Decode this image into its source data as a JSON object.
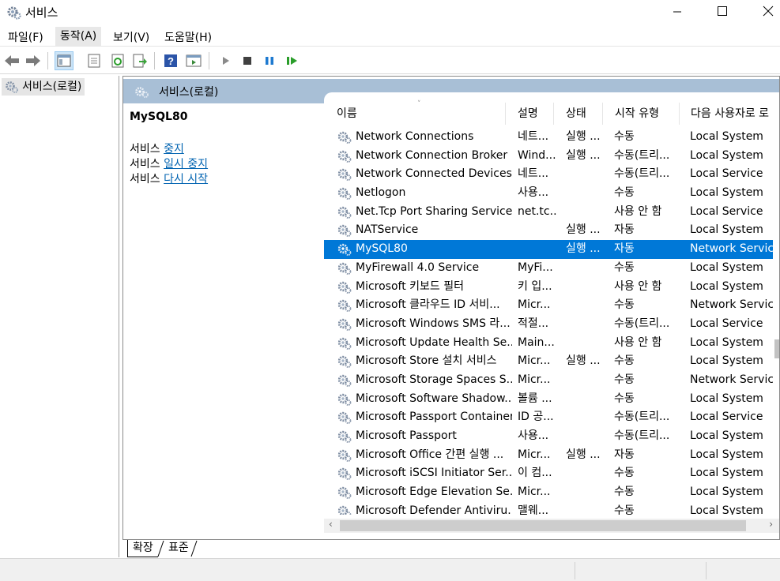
{
  "window": {
    "title": "서비스"
  },
  "menu": {
    "file": "파일(F)",
    "action": "동작(A)",
    "view": "보기(V)",
    "help": "도움말(H)"
  },
  "tree": {
    "root": "서비스(로컬)"
  },
  "main": {
    "header": "서비스(로컬)",
    "selected_service": "MySQL80",
    "actions": [
      {
        "prefix": "서비스 ",
        "link": "중지"
      },
      {
        "prefix": "서비스 ",
        "link": "일시 중지"
      },
      {
        "prefix": "서비스 ",
        "link": "다시 시작"
      }
    ]
  },
  "columns": {
    "name": "이름",
    "description": "설명",
    "status": "상태",
    "startup": "시작 유형",
    "logon": "다음 사용자로 로"
  },
  "rows": [
    {
      "name": "Network Connections",
      "desc": "네트...",
      "status": "실행 ...",
      "start": "수동",
      "logon": "Local System"
    },
    {
      "name": "Network Connection Broker",
      "desc": "Wind...",
      "status": "실행 ...",
      "start": "수동(트리...",
      "logon": "Local System"
    },
    {
      "name": "Network Connected Devices...",
      "desc": "네트...",
      "status": "",
      "start": "수동(트리...",
      "logon": "Local Service"
    },
    {
      "name": "Netlogon",
      "desc": "사용...",
      "status": "",
      "start": "수동",
      "logon": "Local System"
    },
    {
      "name": "Net.Tcp Port Sharing Service",
      "desc": "net.tc...",
      "status": "",
      "start": "사용 안 함",
      "logon": "Local Service"
    },
    {
      "name": "NATService",
      "desc": "",
      "status": "실행 ...",
      "start": "자동",
      "logon": "Local System"
    },
    {
      "name": "MySQL80",
      "desc": "",
      "status": "실행 ...",
      "start": "자동",
      "logon": "Network Service",
      "selected": true
    },
    {
      "name": "MyFirewall 4.0 Service",
      "desc": "MyFi...",
      "status": "",
      "start": "수동",
      "logon": "Local System"
    },
    {
      "name": "Microsoft 키보드 필터",
      "desc": "키 입...",
      "status": "",
      "start": "사용 안 함",
      "logon": "Local System"
    },
    {
      "name": "Microsoft 클라우드 ID 서비...",
      "desc": "Micr...",
      "status": "",
      "start": "수동",
      "logon": "Network Service"
    },
    {
      "name": "Microsoft Windows SMS 라...",
      "desc": "적절...",
      "status": "",
      "start": "수동(트리...",
      "logon": "Local Service"
    },
    {
      "name": "Microsoft Update Health Se...",
      "desc": "Main...",
      "status": "",
      "start": "사용 안 함",
      "logon": "Local System"
    },
    {
      "name": "Microsoft Store 설치 서비스",
      "desc": "Micr...",
      "status": "실행 ...",
      "start": "수동",
      "logon": "Local System"
    },
    {
      "name": "Microsoft Storage Spaces S...",
      "desc": "Micr...",
      "status": "",
      "start": "수동",
      "logon": "Network Service"
    },
    {
      "name": "Microsoft Software Shadow...",
      "desc": "볼륨 ...",
      "status": "",
      "start": "수동",
      "logon": "Local System"
    },
    {
      "name": "Microsoft Passport Container",
      "desc": "ID 공...",
      "status": "",
      "start": "수동(트리...",
      "logon": "Local Service"
    },
    {
      "name": "Microsoft Passport",
      "desc": "사용...",
      "status": "",
      "start": "수동(트리...",
      "logon": "Local System"
    },
    {
      "name": "Microsoft Office 간편 실행 ...",
      "desc": "Micr...",
      "status": "실행 ...",
      "start": "자동",
      "logon": "Local System"
    },
    {
      "name": "Microsoft iSCSI Initiator Ser...",
      "desc": "이 컴...",
      "status": "",
      "start": "수동",
      "logon": "Local System"
    },
    {
      "name": "Microsoft Edge Elevation Se...",
      "desc": "Micr...",
      "status": "",
      "start": "수동",
      "logon": "Local System"
    },
    {
      "name": "Microsoft Defender Antiviru...",
      "desc": "맬웨...",
      "status": "",
      "start": "수동",
      "logon": "Local System"
    }
  ],
  "tabs": {
    "extended": "확장",
    "standard": "표준"
  },
  "icons": {
    "app": "gear-icon",
    "back": "back-arrow-icon",
    "forward": "forward-arrow-icon",
    "play": "play-icon",
    "stop": "stop-icon",
    "pause": "pause-icon",
    "restart": "restart-icon"
  },
  "colors": {
    "selection": "#0078d7",
    "header_band": "#a8bfd6",
    "link": "#0063b1"
  }
}
